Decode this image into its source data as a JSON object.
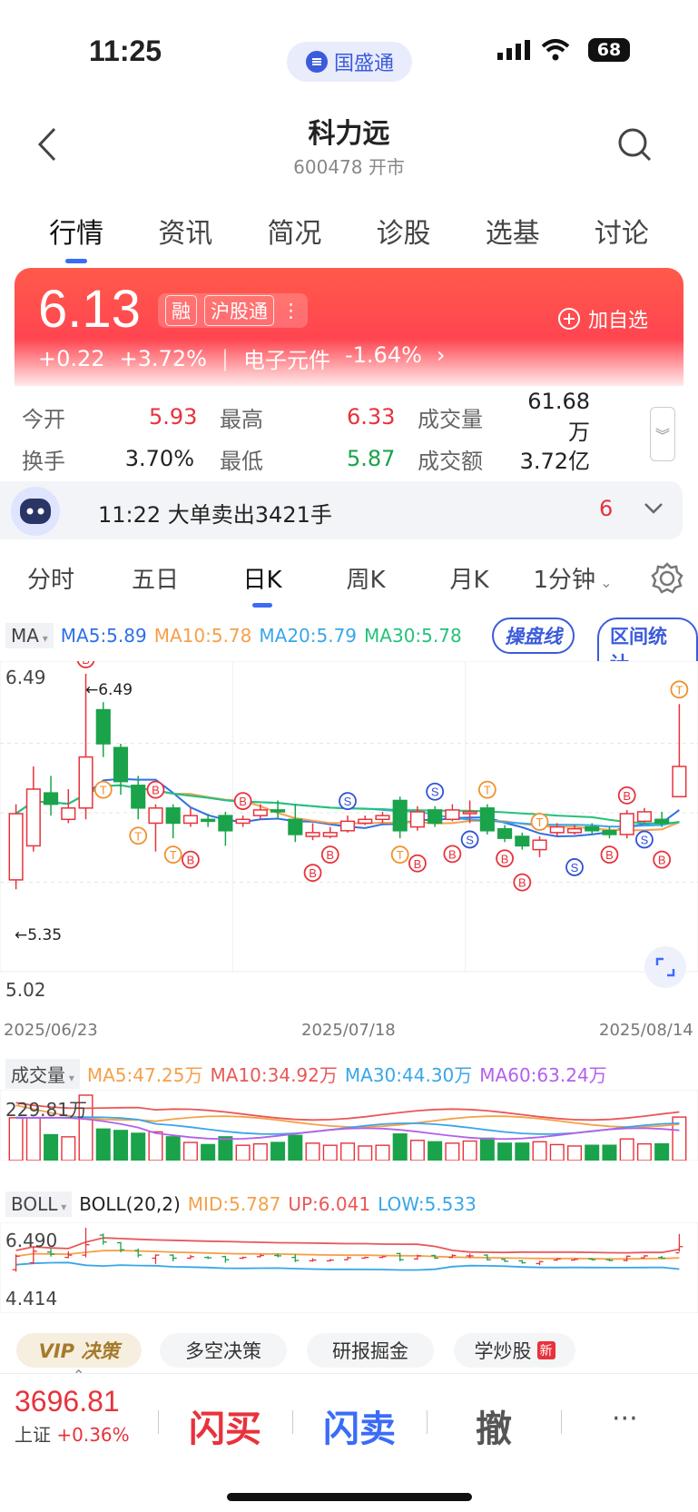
{
  "status": {
    "time": "11:25",
    "app_name": "国盛通",
    "battery": "68"
  },
  "nav": {
    "title": "科力远",
    "subtitle": "600478 开市"
  },
  "tabs": [
    "行情",
    "资讯",
    "简况",
    "诊股",
    "选基",
    "讨论"
  ],
  "quote": {
    "price": "6.13",
    "badge_rong": "融",
    "badge_hgt": "沪股通",
    "change": "+0.22",
    "change_pct": "+3.72%",
    "sector": "电子元件",
    "sector_pct": "-1.64%",
    "add_fav": "加自选"
  },
  "stats": [
    {
      "label": "今开",
      "value": "5.93",
      "color": "#e8323c"
    },
    {
      "label": "最高",
      "value": "6.33",
      "color": "#e8323c"
    },
    {
      "label": "成交量",
      "value": "61.68万",
      "color": "#222222"
    },
    {
      "label": "换手",
      "value": "3.70%",
      "color": "#222222"
    },
    {
      "label": "最低",
      "value": "5.87",
      "color": "#1aa34a"
    },
    {
      "label": "成交额",
      "value": "3.72亿",
      "color": "#222222"
    }
  ],
  "alert": {
    "text": "11:22 大单卖出3421手",
    "count": "6"
  },
  "ktabs": [
    "分时",
    "五日",
    "日K",
    "周K",
    "月K",
    "1分钟"
  ],
  "ma_legend": {
    "label": "MA",
    "ma5": "MA5:5.89",
    "ma10": "MA10:5.78",
    "ma20": "MA20:5.79",
    "ma30": "MA30:5.78",
    "btn1": "操盘线",
    "btn2": "区间统计"
  },
  "chart": {
    "ymax_label": "6.49",
    "ymin_label": "5.02",
    "high_marker": "←6.49",
    "low_marker": "←5.35",
    "dates": [
      "2025/06/23",
      "2025/07/18",
      "2025/08/14"
    ]
  },
  "vol_legend": {
    "label": "成交量",
    "ma5": "MA5:47.25万",
    "ma10": "MA10:34.92万",
    "ma30": "MA30:44.30万",
    "ma60": "MA60:63.24万",
    "ymax": "229.81万"
  },
  "boll_legend": {
    "label": "BOLL",
    "param": "BOLL(20,2)",
    "mid": "MID:5.787",
    "up": "UP:6.041",
    "low": "LOW:5.533",
    "ymax": "6.490",
    "ymin": "4.414"
  },
  "chips": [
    {
      "label": "VIP 决策"
    },
    {
      "label": "多空决策"
    },
    {
      "label": "研报掘金"
    },
    {
      "label": "学炒股",
      "badge": "新"
    }
  ],
  "bottom": {
    "index_value": "3696.81",
    "index_name": "上证",
    "index_pct": "+0.36%",
    "buy": "闪买",
    "sell": "闪卖",
    "cancel": "撤",
    "more": "···"
  },
  "colors": {
    "up": "#e8323c",
    "down": "#1aa34a",
    "accent": "#3b6cf6",
    "ma5": "#2f6fe6",
    "ma10": "#f5a04a",
    "ma20": "#3aa6e8",
    "ma30": "#24c27a"
  },
  "chart_data": {
    "type": "candlestick",
    "x_range": [
      "2025/06/23",
      "2025/08/14"
    ],
    "ylim": [
      5.02,
      6.49
    ],
    "candles": [
      {
        "o": 5.4,
        "c": 5.75,
        "h": 5.8,
        "l": 5.35
      },
      {
        "o": 5.58,
        "c": 5.88,
        "h": 6.0,
        "l": 5.55
      },
      {
        "o": 5.86,
        "c": 5.8,
        "h": 5.95,
        "l": 5.74
      },
      {
        "o": 5.72,
        "c": 5.78,
        "h": 5.88,
        "l": 5.7
      },
      {
        "o": 5.78,
        "c": 6.05,
        "h": 6.49,
        "l": 5.72
      },
      {
        "o": 6.3,
        "c": 6.12,
        "h": 6.34,
        "l": 6.05
      },
      {
        "o": 6.1,
        "c": 5.92,
        "h": 6.12,
        "l": 5.85
      },
      {
        "o": 5.9,
        "c": 5.78,
        "h": 5.95,
        "l": 5.72
      },
      {
        "o": 5.7,
        "c": 5.78,
        "h": 5.8,
        "l": 5.55
      },
      {
        "o": 5.78,
        "c": 5.7,
        "h": 5.8,
        "l": 5.62
      },
      {
        "o": 5.7,
        "c": 5.74,
        "h": 5.78,
        "l": 5.68
      },
      {
        "o": 5.72,
        "c": 5.71,
        "h": 5.75,
        "l": 5.68
      },
      {
        "o": 5.74,
        "c": 5.66,
        "h": 5.76,
        "l": 5.58
      },
      {
        "o": 5.7,
        "c": 5.72,
        "h": 5.74,
        "l": 5.68
      },
      {
        "o": 5.74,
        "c": 5.77,
        "h": 5.8,
        "l": 5.72
      },
      {
        "o": 5.77,
        "c": 5.76,
        "h": 5.82,
        "l": 5.72
      },
      {
        "o": 5.72,
        "c": 5.64,
        "h": 5.8,
        "l": 5.6
      },
      {
        "o": 5.63,
        "c": 5.65,
        "h": 5.7,
        "l": 5.61
      },
      {
        "o": 5.63,
        "c": 5.65,
        "h": 5.68,
        "l": 5.62
      },
      {
        "o": 5.66,
        "c": 5.71,
        "h": 5.74,
        "l": 5.65
      },
      {
        "o": 5.7,
        "c": 5.72,
        "h": 5.74,
        "l": 5.69
      },
      {
        "o": 5.72,
        "c": 5.74,
        "h": 5.76,
        "l": 5.7
      },
      {
        "o": 5.82,
        "c": 5.66,
        "h": 5.84,
        "l": 5.62
      },
      {
        "o": 5.68,
        "c": 5.76,
        "h": 5.79,
        "l": 5.66
      },
      {
        "o": 5.77,
        "c": 5.7,
        "h": 5.79,
        "l": 5.68
      },
      {
        "o": 5.72,
        "c": 5.77,
        "h": 5.8,
        "l": 5.71
      },
      {
        "o": 5.76,
        "c": 5.76,
        "h": 5.82,
        "l": 5.7
      },
      {
        "o": 5.78,
        "c": 5.66,
        "h": 5.8,
        "l": 5.64
      },
      {
        "o": 5.67,
        "c": 5.62,
        "h": 5.69,
        "l": 5.6
      },
      {
        "o": 5.63,
        "c": 5.58,
        "h": 5.65,
        "l": 5.56
      },
      {
        "o": 5.56,
        "c": 5.61,
        "h": 5.63,
        "l": 5.52
      },
      {
        "o": 5.65,
        "c": 5.68,
        "h": 5.7,
        "l": 5.63
      },
      {
        "o": 5.65,
        "c": 5.67,
        "h": 5.69,
        "l": 5.64
      },
      {
        "o": 5.68,
        "c": 5.66,
        "h": 5.7,
        "l": 5.64
      },
      {
        "o": 5.66,
        "c": 5.64,
        "h": 5.68,
        "l": 5.62
      },
      {
        "o": 5.64,
        "c": 5.75,
        "h": 5.77,
        "l": 5.62
      },
      {
        "o": 5.71,
        "c": 5.76,
        "h": 5.78,
        "l": 5.7
      },
      {
        "o": 5.72,
        "c": 5.7,
        "h": 5.76,
        "l": 5.68
      },
      {
        "o": 5.84,
        "c": 6.0,
        "h": 6.33,
        "l": 5.87
      }
    ],
    "markers_note": "B/S/T signal markers"
  }
}
